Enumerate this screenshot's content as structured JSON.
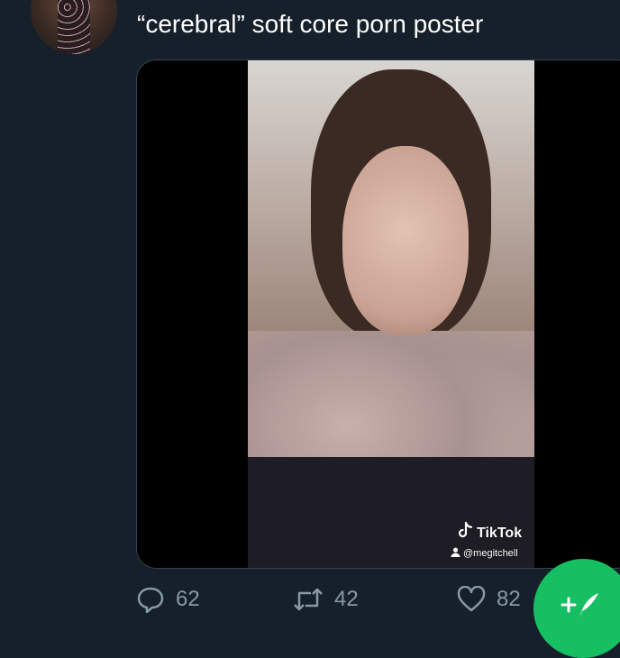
{
  "tweet": {
    "text": "“cerebral” soft core porn poster"
  },
  "media": {
    "watermark_brand": "TikTok",
    "watermark_handle": "@megitchell"
  },
  "actions": {
    "reply_count": "62",
    "retweet_count": "42",
    "like_count": "82"
  },
  "colors": {
    "background": "#15202b",
    "card_border": "#38444d",
    "action_gray": "#8899a6",
    "fab_green": "#17bf63"
  },
  "icons": [
    "reply-icon",
    "retweet-icon",
    "like-icon",
    "compose-tweet-icon",
    "tiktok-logo-icon",
    "user-icon"
  ]
}
